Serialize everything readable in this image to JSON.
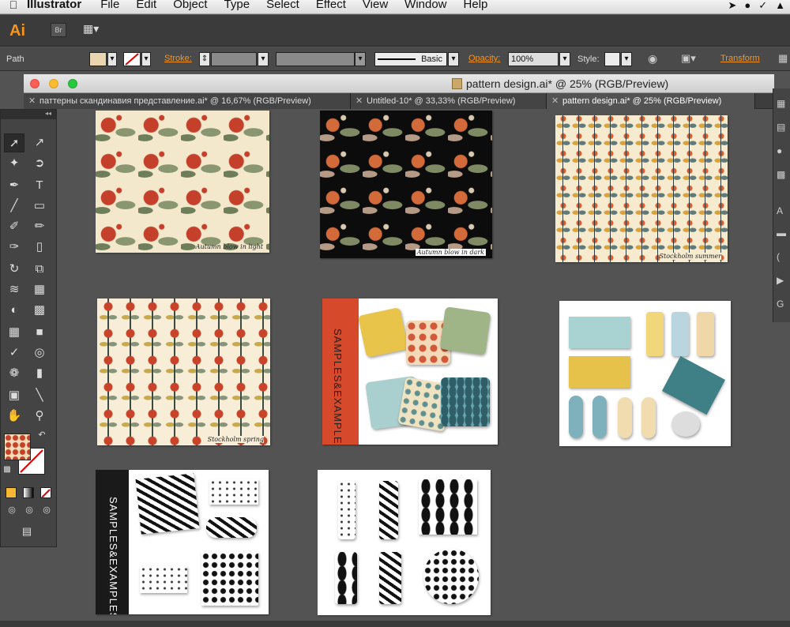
{
  "menubar": {
    "app_name": "Illustrator",
    "items": [
      "File",
      "Edit",
      "Object",
      "Type",
      "Select",
      "Effect",
      "View",
      "Window",
      "Help"
    ]
  },
  "appbar": {
    "logo": "Ai",
    "bridge": "Br"
  },
  "control_bar": {
    "selection_type": "Path",
    "stroke_label": "Stroke:",
    "brush_value": "Basic",
    "opacity_label": "Opacity:",
    "opacity_value": "100%",
    "style_label": "Style:",
    "transform_label": "Transform"
  },
  "window": {
    "title": "pattern design.ai* @ 25% (RGB/Preview)"
  },
  "tabs": [
    {
      "label": "паттерны скандинавия представление.ai* @ 16,67% (RGB/Preview)",
      "active": false
    },
    {
      "label": "Untitled-10* @ 33,33% (RGB/Preview)",
      "active": false
    },
    {
      "label": "pattern design.ai* @ 25% (RGB/Preview)",
      "active": true
    }
  ],
  "artboards": {
    "autumn_light_caption": "Autumn blow in light",
    "autumn_dark_caption": "Autumn blow in dark",
    "summer_caption": "Stockholm summer",
    "spring_caption": "Stockholm spring",
    "samples_title_1": "SAMPLES&EXAMPLES",
    "samples_title_2": "SAMPLES&EXAMPLES"
  },
  "colors": {
    "accent_orange": "#f7941d",
    "panel_dark": "#444444",
    "canvas": "#535353",
    "samples_band_red": "#d6492a",
    "samples_band_black": "#1a1a1a"
  }
}
